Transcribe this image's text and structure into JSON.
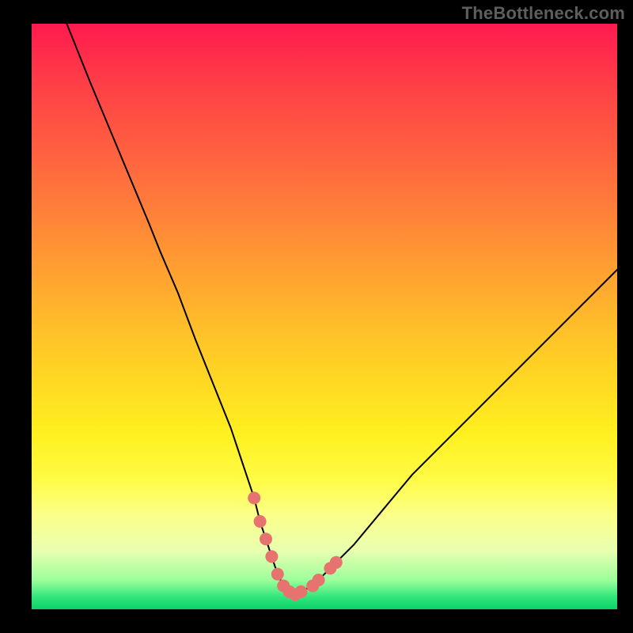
{
  "watermark": "TheBottleneck.com",
  "chart_data": {
    "type": "line",
    "title": "",
    "xlabel": "",
    "ylabel": "",
    "xlim": [
      0,
      100
    ],
    "ylim": [
      0,
      100
    ],
    "x": [
      6,
      10,
      15,
      20,
      22,
      25,
      28,
      30,
      32,
      34,
      36,
      37,
      38,
      39,
      40,
      41,
      42,
      43,
      44,
      45,
      46,
      48,
      50,
      55,
      60,
      65,
      70,
      75,
      80,
      85,
      90,
      95,
      100
    ],
    "values": [
      100,
      90,
      78,
      66,
      61,
      54,
      46,
      41,
      36,
      31,
      25,
      22,
      19,
      15,
      12,
      9,
      6,
      4,
      3,
      2.5,
      3,
      4,
      6,
      11,
      17,
      23,
      28,
      33,
      38,
      43,
      48,
      53,
      58
    ],
    "marker_points": [
      {
        "x": 38,
        "y": 19
      },
      {
        "x": 39,
        "y": 15
      },
      {
        "x": 40,
        "y": 12
      },
      {
        "x": 41,
        "y": 9
      },
      {
        "x": 42,
        "y": 6
      },
      {
        "x": 43,
        "y": 4
      },
      {
        "x": 44,
        "y": 3
      },
      {
        "x": 45,
        "y": 2.5
      },
      {
        "x": 46,
        "y": 3
      },
      {
        "x": 48,
        "y": 4
      },
      {
        "x": 49,
        "y": 5
      },
      {
        "x": 51,
        "y": 7
      },
      {
        "x": 52,
        "y": 8
      }
    ],
    "colors": {
      "curve": "#000000",
      "markers": "#e7736f",
      "gradient_top": "#ff1a4f",
      "gradient_mid": "#fff01f",
      "gradient_bottom": "#0bd166"
    }
  }
}
